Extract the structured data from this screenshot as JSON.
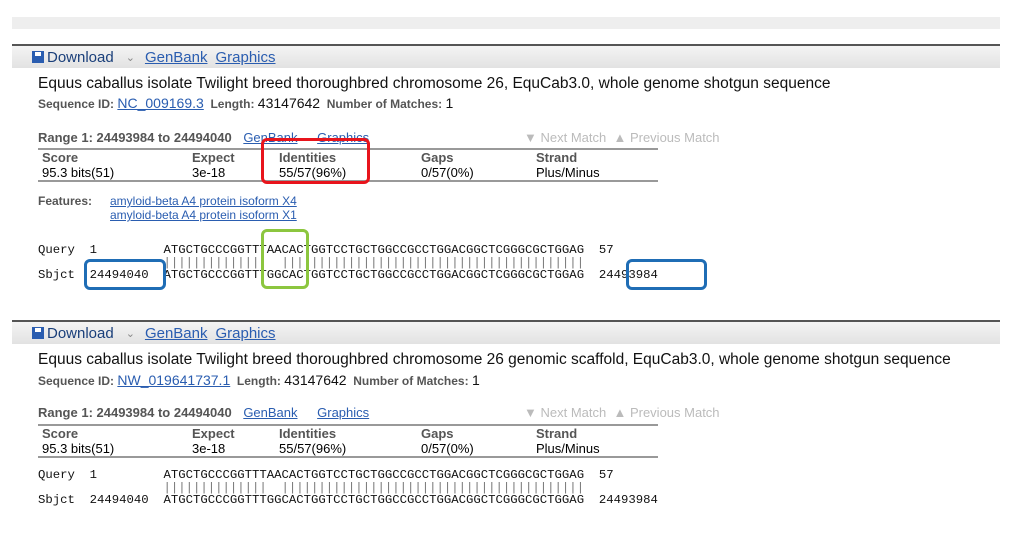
{
  "toolbar": {
    "download": "Download",
    "genbank": "GenBank",
    "graphics": "Graphics"
  },
  "hits": [
    {
      "title": "Equus caballus isolate Twilight breed thoroughbred chromosome 26, EquCab3.0, whole genome shotgun sequence",
      "seq_id_label": "Sequence ID:",
      "seq_id": "NC_009169.3",
      "length_label": "Length:",
      "length": "43147642",
      "matches_label": "Number of Matches:",
      "matches": "1",
      "range": "Range 1: 24493984 to 24494040",
      "range_genbank": "GenBank",
      "range_graphics": "Graphics",
      "next": "▼ Next Match",
      "prev": "▲ Previous Match",
      "stats": {
        "score_h": "Score",
        "score": "95.3 bits(51)",
        "expect_h": "Expect",
        "expect": "3e-18",
        "ident_h": "Identities",
        "ident": "55/57(96%)",
        "gaps_h": "Gaps",
        "gaps": "0/57(0%)",
        "strand_h": "Strand",
        "strand": "Plus/Minus"
      },
      "features_label": "Features:",
      "features": [
        "amyloid-beta A4 protein isoform X4",
        "amyloid-beta A4 protein isoform X1"
      ],
      "query": "Query  1         ATGCTGCCCGGTTTAACACTGGTCCTGCTGGCCGCCTGGACGGCTCGGGCGCTGGAG  57",
      "midline": "                 ||||||||||||||  |||||||||||||||||||||||||||||||||||||||||",
      "sbjct": "Sbjct  24494040  ATGCTGCCCGGTTTGGCACTGGTCCTGCTGGCCGCCTGGACGGCTCGGGCGCTGGAG  24493984"
    },
    {
      "title": "Equus caballus isolate Twilight breed thoroughbred chromosome 26 genomic scaffold, EquCab3.0, whole genome shotgun sequence",
      "seq_id_label": "Sequence ID:",
      "seq_id": "NW_019641737.1",
      "length_label": "Length:",
      "length": "43147642",
      "matches_label": "Number of Matches:",
      "matches": "1",
      "range": "Range 1: 24493984 to 24494040",
      "range_genbank": "GenBank",
      "range_graphics": "Graphics",
      "next": "▼ Next Match",
      "prev": "▲ Previous Match",
      "stats": {
        "score_h": "Score",
        "score": "95.3 bits(51)",
        "expect_h": "Expect",
        "expect": "3e-18",
        "ident_h": "Identities",
        "ident": "55/57(96%)",
        "gaps_h": "Gaps",
        "gaps": "0/57(0%)",
        "strand_h": "Strand",
        "strand": "Plus/Minus"
      },
      "query": "Query  1         ATGCTGCCCGGTTTAACACTGGTCCTGCTGGCCGCCTGGACGGCTCGGGCGCTGGAG  57",
      "midline": "                 ||||||||||||||  |||||||||||||||||||||||||||||||||||||||||",
      "sbjct": "Sbjct  24494040  ATGCTGCCCGGTTTGGCACTGGTCCTGCTGGCCGCCTGGACGGCTCGGGCGCTGGAG  24493984"
    }
  ],
  "annotation_colors": {
    "identities": "#e8141c",
    "mismatch": "#8cc63f",
    "coordinates": "#1f6db5"
  }
}
